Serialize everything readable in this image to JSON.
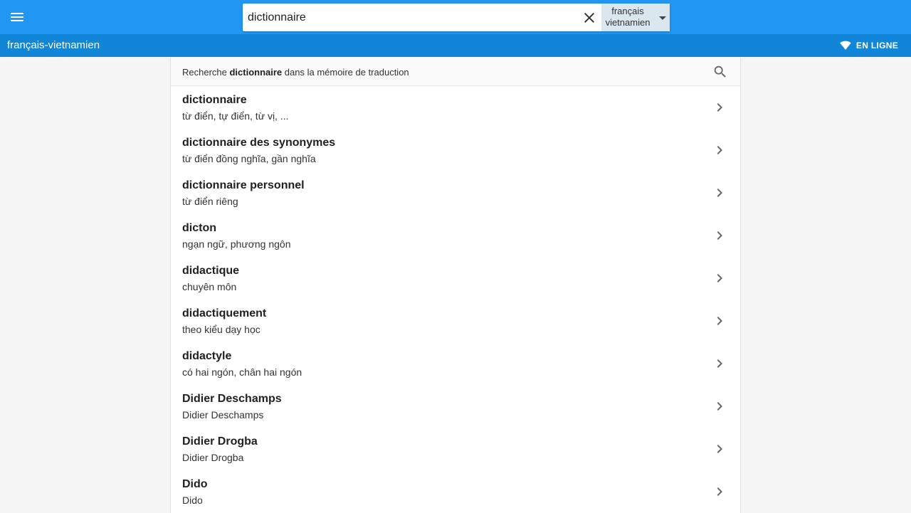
{
  "header": {
    "search_value": "dictionnaire",
    "language": {
      "line1": "français",
      "line2": "vietnamien"
    }
  },
  "subbar": {
    "title": "français-vietnamien",
    "status": "EN LIGNE"
  },
  "memory_search": {
    "prefix": "Recherche ",
    "term": "dictionnaire",
    "suffix": " dans la mémoire de traduction"
  },
  "results": [
    {
      "term": "dictionnaire",
      "translation": "từ điển, tự điển, từ vị, ..."
    },
    {
      "term": "dictionnaire des synonymes",
      "translation": "từ điển đồng nghĩa, gần nghĩa"
    },
    {
      "term": "dictionnaire personnel",
      "translation": "từ điển riêng"
    },
    {
      "term": "dicton",
      "translation": "ngạn ngữ, phương ngôn"
    },
    {
      "term": "didactique",
      "translation": "chuyên môn"
    },
    {
      "term": "didactiquement",
      "translation": "theo kiểu dạy học"
    },
    {
      "term": "didactyle",
      "translation": "có hai ngón, chân hai ngón"
    },
    {
      "term": "Didier Deschamps",
      "translation": "Didier Deschamps"
    },
    {
      "term": "Didier Drogba",
      "translation": "Didier Drogba"
    },
    {
      "term": "Dido",
      "translation": "Dido"
    }
  ],
  "icons": {
    "menu": "menu-icon",
    "clear": "close-icon",
    "caret": "caret-down-icon",
    "online": "wifi-icon",
    "search": "search-icon",
    "row_arrow": "chevron-right-icon"
  },
  "colors": {
    "primary": "#2196f3",
    "subbar": "#1185d8",
    "language_select": "#dbe7ef"
  }
}
